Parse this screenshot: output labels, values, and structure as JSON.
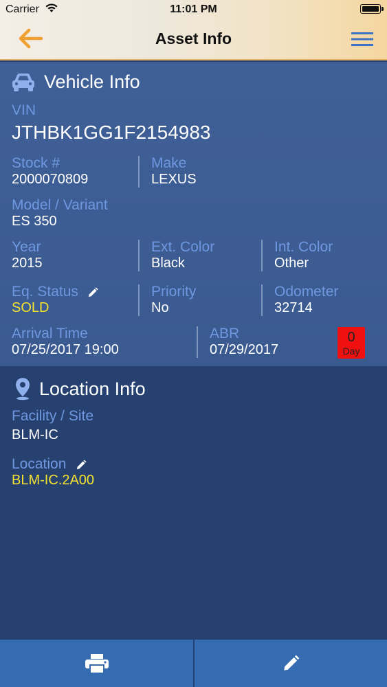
{
  "status_bar": {
    "carrier": "Carrier",
    "time": "11:01 PM"
  },
  "nav": {
    "title": "Asset Info",
    "back_icon": "arrow-left-icon",
    "menu_icon": "hamburger-menu-icon"
  },
  "vehicle": {
    "title": "Vehicle Info",
    "icon": "car-icon",
    "vin_label": "VIN",
    "vin": "JTHBK1GG1F2154983",
    "stock_label": "Stock #",
    "stock": "2000070809",
    "make_label": "Make",
    "make": "LEXUS",
    "model_label": "Model / Variant",
    "model": "ES 350",
    "year_label": "Year",
    "year": "2015",
    "ext_color_label": "Ext. Color",
    "ext_color": "Black",
    "int_color_label": "Int. Color",
    "int_color": "Other",
    "eq_status_label": "Eq. Status",
    "eq_status": "SOLD",
    "priority_label": "Priority",
    "priority": "No",
    "odometer_label": "Odometer",
    "odometer": "32714",
    "arrival_label": "Arrival Time",
    "arrival": "07/25/2017 19:00",
    "abr_label": "ABR",
    "abr": "07/29/2017",
    "day_badge": {
      "count": "0",
      "unit": "Day",
      "color": "#f01010"
    }
  },
  "location": {
    "title": "Location Info",
    "icon": "map-pin-icon",
    "facility_label": "Facility / Site",
    "facility": "BLM-IC",
    "location_label": "Location",
    "location": "BLM-IC.2A00"
  },
  "toolbar": {
    "print_icon": "printer-icon",
    "edit_icon": "pencil-icon"
  },
  "colors": {
    "label": "#6f98e0",
    "highlight": "#f4e330",
    "accent_arrow": "#f0a030",
    "toolbar": "#356bb0"
  }
}
